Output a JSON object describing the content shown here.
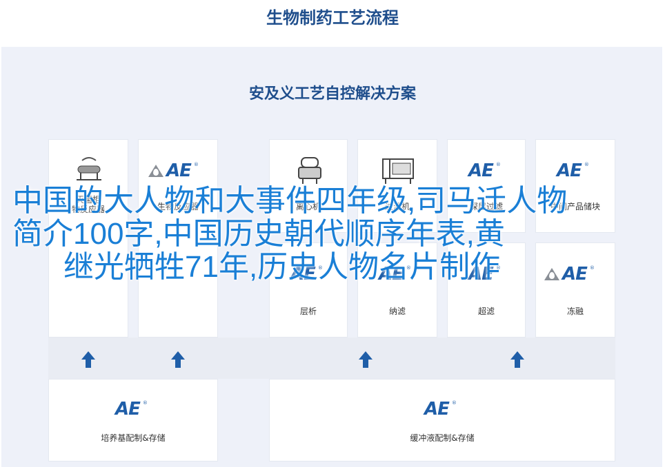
{
  "header": {
    "title": "生物制药工艺流程"
  },
  "panel": {
    "title": "安及义工艺自控解决方案"
  },
  "top_cards": [
    {
      "label": "灭菌柜\n物反应器",
      "icon": "autoclave-icon"
    },
    {
      "label": "生物反应器",
      "icon": "ae-logo"
    },
    {
      "label": "离心机",
      "icon": "centrifuge-icon"
    },
    {
      "label": "过滤机",
      "icon": "filter-machine-icon"
    },
    {
      "label": "深层过滤",
      "icon": "ae-logo"
    },
    {
      "label": "中间产品储块",
      "icon": "ae-logo"
    }
  ],
  "mid_cards": [
    {
      "label": "层析",
      "icon": "ae-logo"
    },
    {
      "label": "纳滤",
      "icon": "ae-logo"
    },
    {
      "label": "超滤",
      "icon": "ae-logo"
    },
    {
      "label": "冻融",
      "icon": "ae-logo"
    }
  ],
  "bottom_cards": [
    {
      "label": "培养基配制&存储"
    },
    {
      "label": "缓冲液配制&存储"
    }
  ],
  "logo": {
    "text": "AE",
    "reg": "®"
  },
  "overlay": {
    "line1": "中国的大人物和大事件四年级,司马迁人物",
    "line2": "简介100字,中国历史朝代顺序年表,黄",
    "line3": "继光牺牲71年,历史人物名片制作"
  },
  "colors": {
    "accent": "#1f5ea8",
    "title": "#1f4e8c",
    "overlay": "#1a7fd6",
    "panel_bg": "#eef1f9"
  }
}
